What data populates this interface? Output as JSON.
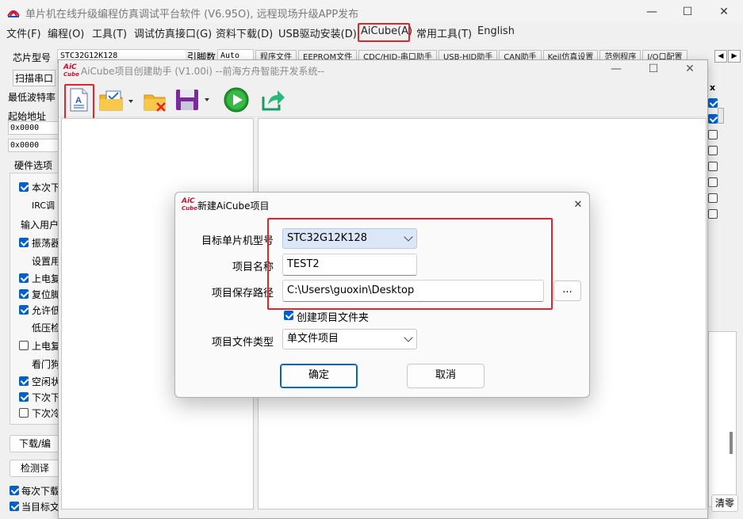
{
  "window": {
    "title": "单片机在线升级编程仿真调试平台软件 (V6.95O), 远程现场升级APP发布",
    "minimize": "—",
    "maximize": "☐",
    "close": "✕"
  },
  "menu": {
    "items": [
      "文件(F)",
      "编程(O)",
      "工具(T)",
      "调试仿真接口(G)",
      "资料下载(D)",
      "USB驱动安装(D)",
      "AiCube(A)",
      "常用工具(T)",
      "English"
    ]
  },
  "left": {
    "chip_label": "芯片型号",
    "chip_value": "STC32G12K128",
    "pin_label": "引脚数",
    "pin_value": "Auto",
    "scan_label": "扫描串口",
    "baud_label": "最低波特率",
    "start_addr_label": "起始地址",
    "addr1": "0x0000",
    "addr2": "0x0000",
    "hw_options_label": "硬件选项",
    "options": [
      "本次下",
      "IRC调",
      "输入用户",
      "振荡器",
      "设置用",
      "上电复",
      "复位脚",
      "允许低",
      "低压检",
      "上电复",
      "看门狗",
      "空闲状",
      "下次下",
      "下次冷"
    ],
    "download_btn": "下载/编",
    "check_btn": "检测译",
    "bottom_checks": [
      "每次下载",
      "当目标文"
    ]
  },
  "tabs": [
    "程序文件",
    "EEPROM文件",
    "CDC/HID-串口助手",
    "USB-HID助手",
    "CAN助手",
    "Keil仿真设置",
    "范例程序",
    "I/O口配置"
  ],
  "right": {
    "partial_label": "x",
    "clear_btn": "清零"
  },
  "assistant": {
    "title": "AiCube项目创建助手 (V1.00i) --前海方舟智能开发系统--",
    "logo_top": "AiC",
    "logo_bottom": "Cube"
  },
  "dialog": {
    "title": "新建AiCube项目",
    "mcu_label": "目标单片机型号",
    "mcu_value": "STC32G12K128",
    "name_label": "项目名称",
    "name_value": "TEST2",
    "path_label": "项目保存路径",
    "path_value": "C:\\Users\\guoxin\\Desktop",
    "browse": "...",
    "create_folder_label": "创建项目文件夹",
    "type_label": "项目文件类型",
    "type_value": "单文件项目",
    "ok": "确定",
    "cancel": "取消"
  },
  "colors": {
    "highlight_red": "#e0262c",
    "accent_blue": "#0067c0",
    "selection_blue": "#dbe7f7"
  }
}
